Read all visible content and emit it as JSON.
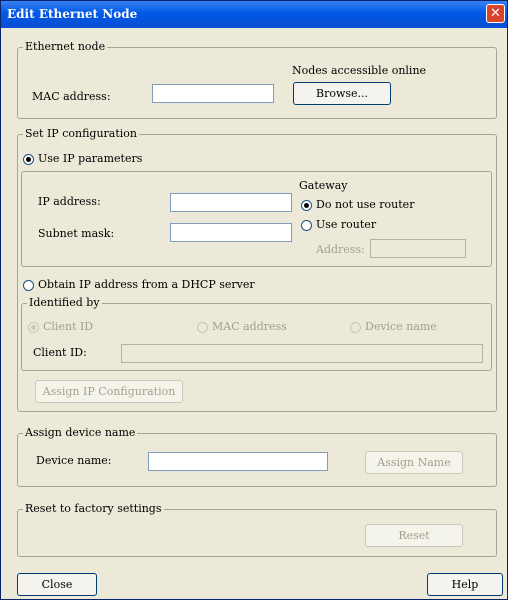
{
  "window": {
    "title": "Edit Ethernet Node",
    "close_glyph": "✕"
  },
  "ethernet_node": {
    "legend": "Ethernet node",
    "mac_label": "MAC address:",
    "mac_value": "",
    "online_label": "Nodes accessible online",
    "browse_button": "Browse..."
  },
  "ip_config": {
    "legend": "Set IP configuration",
    "use_ip_label": "Use IP parameters",
    "use_ip_selected": true,
    "ip_address_label": "IP address:",
    "ip_address_value": "",
    "subnet_label": "Subnet mask:",
    "subnet_value": "",
    "gateway_label": "Gateway",
    "no_router_label": "Do not use router",
    "use_router_label": "Use router",
    "router_address_label": "Address:",
    "router_address_value": "",
    "dhcp_label": "Obtain IP address from a DHCP server",
    "identified_by": {
      "legend": "Identified by",
      "client_id_option": "Client ID",
      "mac_option": "MAC address",
      "device_name_option": "Device name",
      "client_id_label": "Client ID:",
      "client_id_value": ""
    },
    "assign_button": "Assign IP Configuration"
  },
  "device_name": {
    "legend": "Assign device name",
    "label": "Device name:",
    "value": "",
    "assign_button": "Assign Name"
  },
  "factory_reset": {
    "legend": "Reset to factory settings",
    "reset_button": "Reset"
  },
  "footer": {
    "close_button": "Close",
    "help_button": "Help"
  }
}
